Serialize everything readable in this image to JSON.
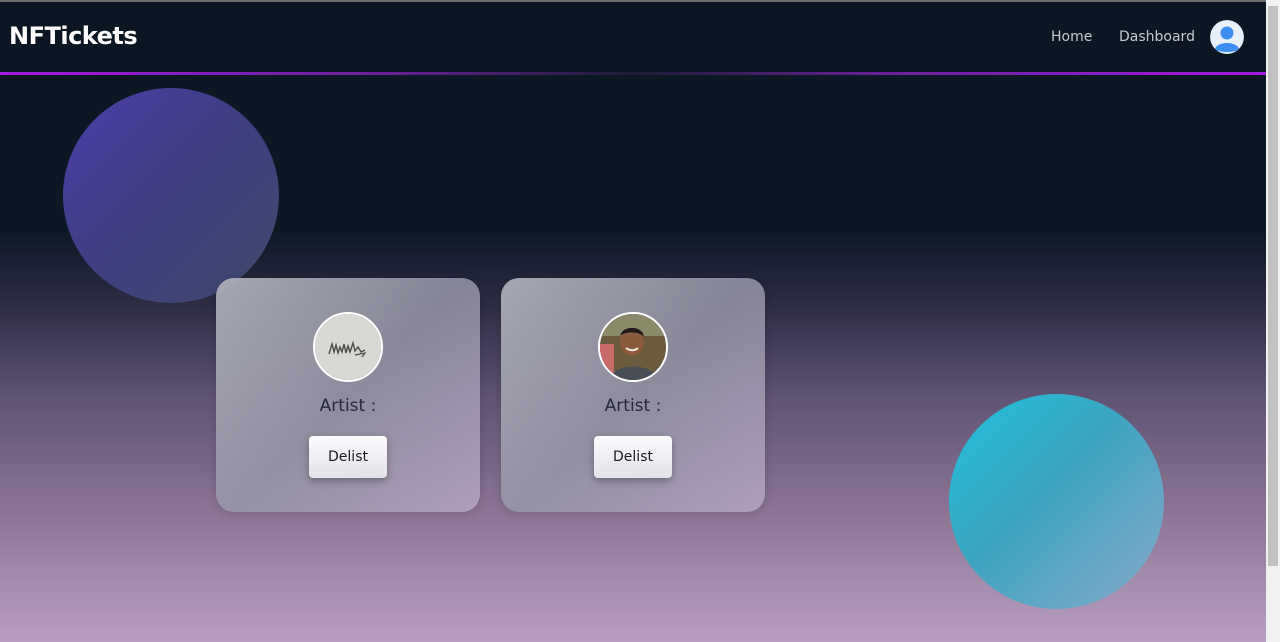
{
  "navbar": {
    "brand": "NFTickets",
    "links": [
      {
        "label": "Home"
      },
      {
        "label": "Dashboard"
      }
    ],
    "avatar_icon": "user-avatar-icon"
  },
  "cards": [
    {
      "artist_label": "Artist :",
      "button_label": "Delist",
      "image": "signature-artwork-image"
    },
    {
      "artist_label": "Artist :",
      "button_label": "Delist",
      "image": "person-photo-image"
    }
  ],
  "colors": {
    "nav_background": "#0b1622",
    "nav_accent_line": "#a21de0",
    "blob_purple": "#4a3fa8",
    "blob_cyan": "#1ec1dc"
  }
}
